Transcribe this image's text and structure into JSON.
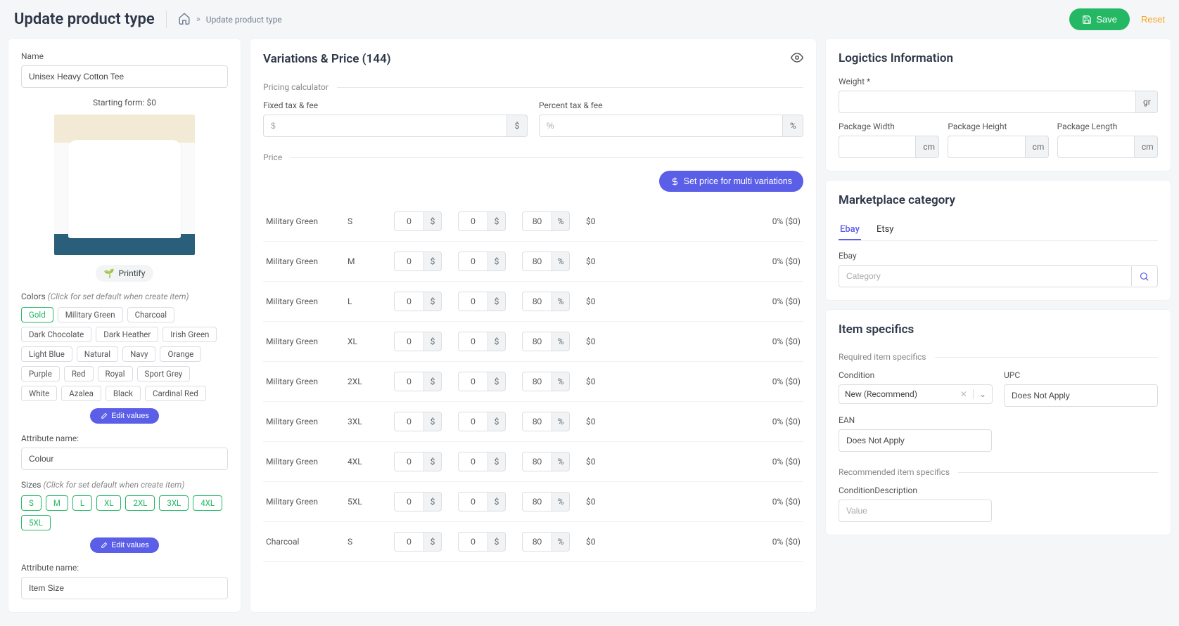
{
  "header": {
    "title": "Update product type",
    "breadcrumb": "Update product type",
    "save_label": "Save",
    "reset_label": "Reset"
  },
  "left": {
    "name_label": "Name",
    "name_value": "Unisex Heavy Cotton Tee",
    "starting": "Starting form: $0",
    "printify": "Printify",
    "colors_label": "Colors",
    "click_hint": "(Click for set default when create item)",
    "colors": [
      "Gold",
      "Military Green",
      "Charcoal",
      "Dark Chocolate",
      "Dark Heather",
      "Irish Green",
      "Light Blue",
      "Natural",
      "Navy",
      "Orange",
      "Purple",
      "Red",
      "Royal",
      "Sport Grey",
      "White",
      "Azalea",
      "Black",
      "Cardinal Red"
    ],
    "colors_selected": [
      "Gold"
    ],
    "edit_values": "Edit values",
    "attr_name_label": "Attribute name:",
    "attr_colour": "Colour",
    "sizes_label": "Sizes",
    "sizes": [
      "S",
      "M",
      "L",
      "XL",
      "2XL",
      "3XL",
      "4XL",
      "5XL"
    ],
    "attr_size": "Item Size"
  },
  "variations": {
    "title": "Variations & Price (144)",
    "calc_label": "Pricing calculator",
    "fixed_label": "Fixed tax & fee",
    "fixed_placeholder": "$",
    "percent_label": "Percent tax & fee",
    "percent_placeholder": "%",
    "price_label": "Price",
    "multi_btn": "Set price for multi variations",
    "dollar": "$",
    "pct": "%",
    "rows": [
      {
        "color": "Military Green",
        "size": "S",
        "v1": "0",
        "v2": "0",
        "v3": "80",
        "price": "$0",
        "pct": "0% ($0)"
      },
      {
        "color": "Military Green",
        "size": "M",
        "v1": "0",
        "v2": "0",
        "v3": "80",
        "price": "$0",
        "pct": "0% ($0)"
      },
      {
        "color": "Military Green",
        "size": "L",
        "v1": "0",
        "v2": "0",
        "v3": "80",
        "price": "$0",
        "pct": "0% ($0)"
      },
      {
        "color": "Military Green",
        "size": "XL",
        "v1": "0",
        "v2": "0",
        "v3": "80",
        "price": "$0",
        "pct": "0% ($0)"
      },
      {
        "color": "Military Green",
        "size": "2XL",
        "v1": "0",
        "v2": "0",
        "v3": "80",
        "price": "$0",
        "pct": "0% ($0)"
      },
      {
        "color": "Military Green",
        "size": "3XL",
        "v1": "0",
        "v2": "0",
        "v3": "80",
        "price": "$0",
        "pct": "0% ($0)"
      },
      {
        "color": "Military Green",
        "size": "4XL",
        "v1": "0",
        "v2": "0",
        "v3": "80",
        "price": "$0",
        "pct": "0% ($0)"
      },
      {
        "color": "Military Green",
        "size": "5XL",
        "v1": "0",
        "v2": "0",
        "v3": "80",
        "price": "$0",
        "pct": "0% ($0)"
      },
      {
        "color": "Charcoal",
        "size": "S",
        "v1": "0",
        "v2": "0",
        "v3": "80",
        "price": "$0",
        "pct": "0% ($0)"
      }
    ]
  },
  "logistics": {
    "title": "Logictics Information",
    "weight_label": "Weight *",
    "gr": "gr",
    "width_label": "Package Width",
    "height_label": "Package Height",
    "length_label": "Package Length",
    "cm": "cm"
  },
  "market": {
    "title": "Marketplace category",
    "tab_ebay": "Ebay",
    "tab_etsy": "Etsy",
    "ebay_label": "Ebay",
    "placeholder": "Category"
  },
  "specifics": {
    "title": "Item specifics",
    "required_label": "Required item specifics",
    "condition_label": "Condition",
    "condition_value": "New (Recommend)",
    "upc_label": "UPC",
    "upc_value": "Does Not Apply",
    "ean_label": "EAN",
    "ean_value": "Does Not Apply",
    "recommended_label": "Recommended item specifics",
    "cond_desc_label": "ConditionDescription",
    "value_placeholder": "Value"
  }
}
